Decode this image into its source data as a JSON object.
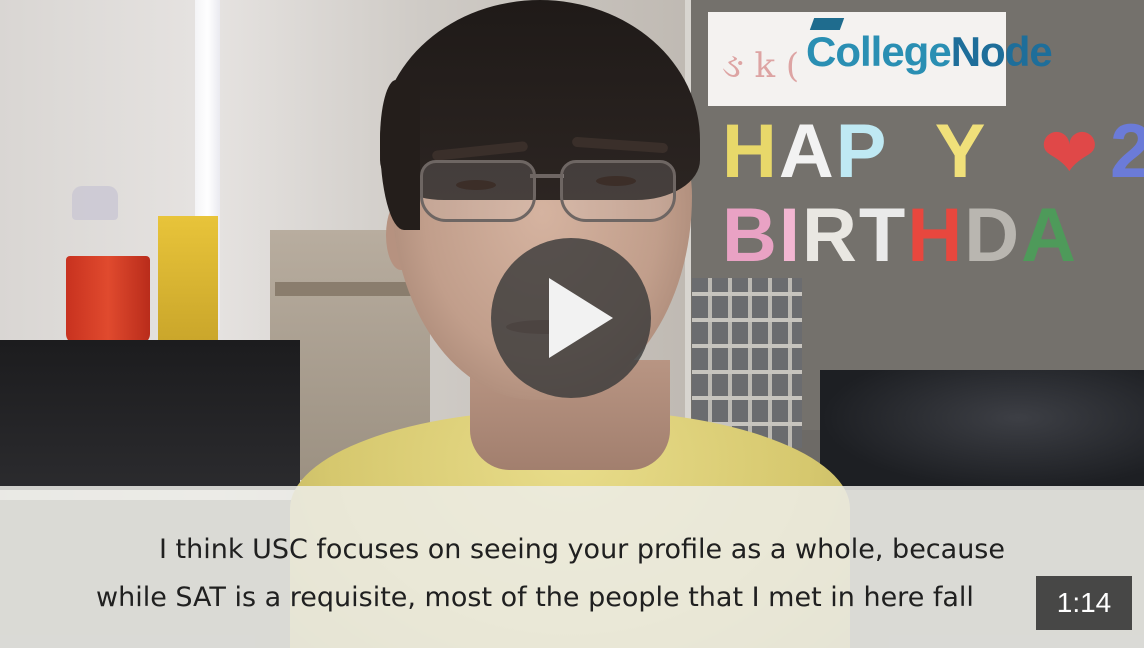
{
  "video": {
    "logo_text_main": "College",
    "logo_text_accent": "Node",
    "banner_line1": [
      "H",
      "A",
      "P",
      " ",
      "Y"
    ],
    "banner_line1_extra": "2",
    "banner_line2": [
      "B",
      "I",
      "R",
      "T",
      "H",
      "D",
      "A"
    ],
    "scribble": "ઙ k (",
    "caption_line1": "I think USC focuses on seeing your profile as a whole, because",
    "caption_line2": "while SAT is a requisite, most of the people that I met in here fall",
    "duration": "1:14",
    "play_icon": "play-icon"
  },
  "colors": {
    "logo_blue": "#2a8fb3",
    "play_bg": "#3a3a3a",
    "badge_bg": "#323232",
    "shirt": "#d6c86e"
  }
}
